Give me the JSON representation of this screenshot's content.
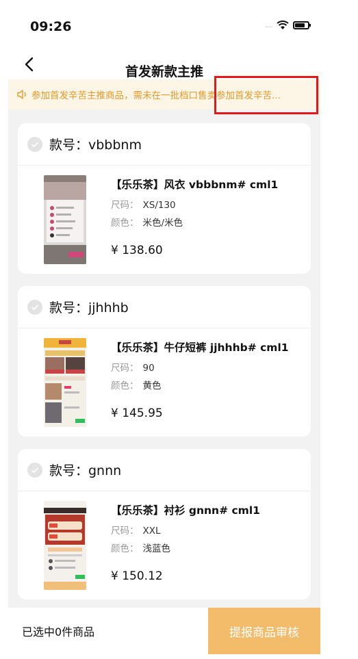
{
  "status_bar": {
    "time": "09:26",
    "signal": "....."
  },
  "nav": {
    "title": "首发新款主推"
  },
  "notice": {
    "text": "参加首发辛苦主推商品，需未在一批档口售卖参加首发辛苦..."
  },
  "products": [
    {
      "style_label": "款号：vbbbnm",
      "name": "【乐乐茶】风衣 vbbbnm# cml1",
      "size_label": "尺码：",
      "size_value": "XS/130",
      "color_label": "颜色：",
      "color_value": "米色/米色",
      "price": "¥ 138.60"
    },
    {
      "style_label": "款号：jjhhhb",
      "name": "【乐乐茶】牛仔短裤 jjhhhb# cml1",
      "size_label": "尺码：",
      "size_value": "90",
      "color_label": "颜色：",
      "color_value": "黄色",
      "price": "¥ 145.95"
    },
    {
      "style_label": "款号：gnnn",
      "name": "【乐乐茶】衬衫 gnnn# cml1",
      "size_label": "尺码：",
      "size_value": "XXL",
      "color_label": "颜色：",
      "color_value": "浅蓝色",
      "price": "¥ 150.12"
    }
  ],
  "footer": {
    "selected_text": "已选中0件商品",
    "submit_label": "提报商品审核"
  },
  "colors": {
    "accent": "#f3bc6a",
    "notice_text": "#e49a2b",
    "notice_bg": "#fdf5e6",
    "highlight": "#e61717"
  },
  "icons": {
    "back": "chevron-left-icon",
    "notice": "speaker-icon",
    "check": "check-circle-icon"
  }
}
